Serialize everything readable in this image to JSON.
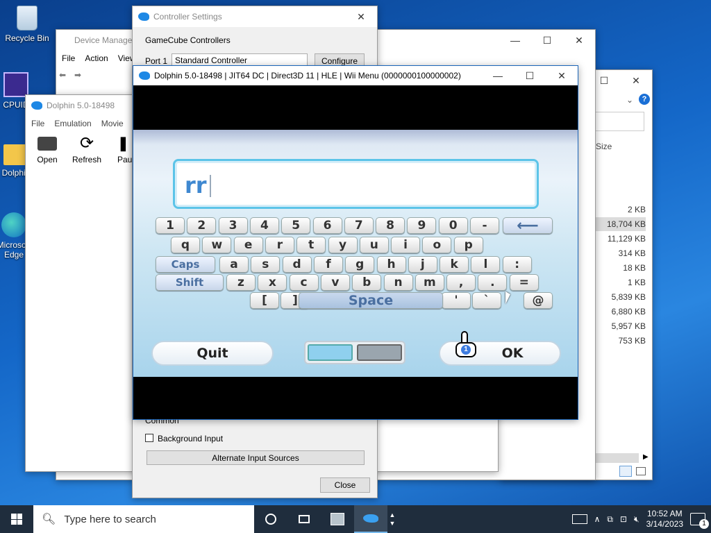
{
  "desktop": {
    "icons": [
      {
        "label": "Recycle Bin"
      },
      {
        "label": "CPUID"
      },
      {
        "label": "Dolphin"
      },
      {
        "label": "Microsoft Edge"
      }
    ]
  },
  "device_manager": {
    "title": "Device Manager",
    "menu": [
      "File",
      "Action",
      "View"
    ]
  },
  "explorer": {
    "size_header": "Size",
    "sizes": [
      "2 KB",
      "18,704 KB",
      "11,129 KB",
      "314 KB",
      "18 KB",
      "1 KB",
      "5,839 KB",
      "6,880 KB",
      "5,957 KB",
      "753 KB"
    ]
  },
  "dolphin_main": {
    "title": "Dolphin 5.0-18498",
    "menu": [
      "File",
      "Emulation",
      "Movie"
    ],
    "toolbar": {
      "open": "Open",
      "refresh": "Refresh",
      "pause": "Pau"
    }
  },
  "controller_settings": {
    "title": "Controller Settings",
    "section": "GameCube Controllers",
    "port_label": "Port 1",
    "port_value": "Standard Controller",
    "configure": "Configure",
    "common": "Common",
    "background_input": "Background Input",
    "alt_sources": "Alternate Input Sources",
    "close": "Close"
  },
  "render_window": {
    "title": "Dolphin 5.0-18498 | JIT64 DC | Direct3D 11 | HLE | Wii Menu (0000000100000002)",
    "input_text": "rr",
    "rows": {
      "r1": [
        "1",
        "2",
        "3",
        "4",
        "5",
        "6",
        "7",
        "8",
        "9",
        "0",
        "-"
      ],
      "r2": [
        "q",
        "w",
        "e",
        "r",
        "t",
        "y",
        "u",
        "i",
        "o",
        "p"
      ],
      "r3": [
        "a",
        "s",
        "d",
        "f",
        "g",
        "h",
        "j",
        "k",
        "l",
        ":"
      ],
      "r4": [
        "z",
        "x",
        "c",
        "v",
        "b",
        "n",
        "m",
        ",",
        ".",
        "="
      ],
      "r5": [
        "[",
        "]",
        "'",
        "`",
        "@"
      ]
    },
    "caps": "Caps",
    "shift": "Shift",
    "space": "Space",
    "quit": "Quit",
    "ok": "OK",
    "cursor_badge": "1"
  },
  "taskbar": {
    "search_placeholder": "Type here to search",
    "time": "10:52 AM",
    "date": "3/14/2023",
    "notif_count": "1"
  }
}
